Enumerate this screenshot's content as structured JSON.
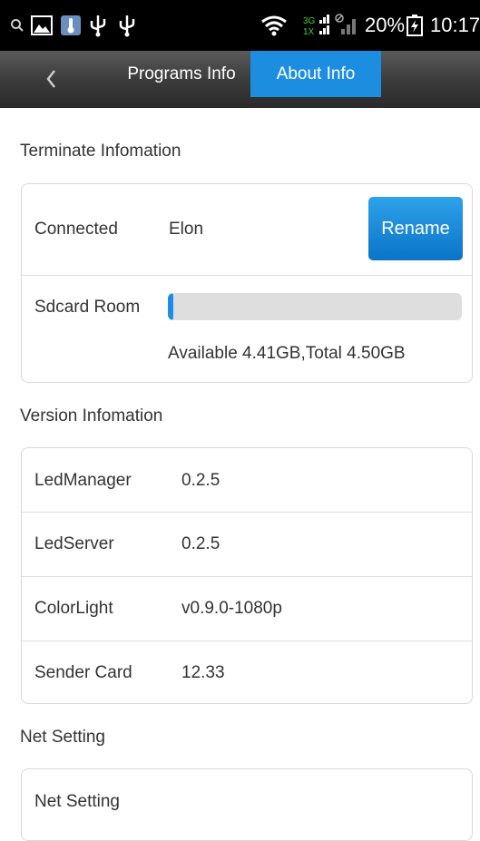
{
  "status_bar": {
    "battery_percent": "20%",
    "time": "10:17",
    "network_label_top": "3G",
    "network_label_bottom": "1X",
    "icons": [
      "search-icon",
      "gallery-icon",
      "thermometer-icon",
      "usb-icon",
      "usb-icon",
      "wifi-icon",
      "signal-icon",
      "battery-icon"
    ]
  },
  "toolbar": {
    "tabs": [
      {
        "label": "Programs Info",
        "active": false
      },
      {
        "label": "About Info",
        "active": true
      }
    ],
    "accent_color": "#1d8de0"
  },
  "terminate": {
    "section_title": "Terminate Infomation",
    "connected_label": "Connected",
    "connected_value": "Elon",
    "rename_label": "Rename",
    "sdcard_label": "Sdcard Room",
    "storage_text": "Available 4.41GB,Total 4.50GB",
    "used_fraction": 0.02
  },
  "version": {
    "section_title": "Version Infomation",
    "rows": [
      {
        "label": "LedManager",
        "value": "0.2.5"
      },
      {
        "label": "LedServer",
        "value": "0.2.5"
      },
      {
        "label": "ColorLight",
        "value": "v0.9.0-1080p"
      },
      {
        "label": "Sender Card",
        "value": "12.33"
      }
    ]
  },
  "net": {
    "section_title": "Net Setting",
    "rows": [
      {
        "label": "Net Setting"
      }
    ]
  }
}
